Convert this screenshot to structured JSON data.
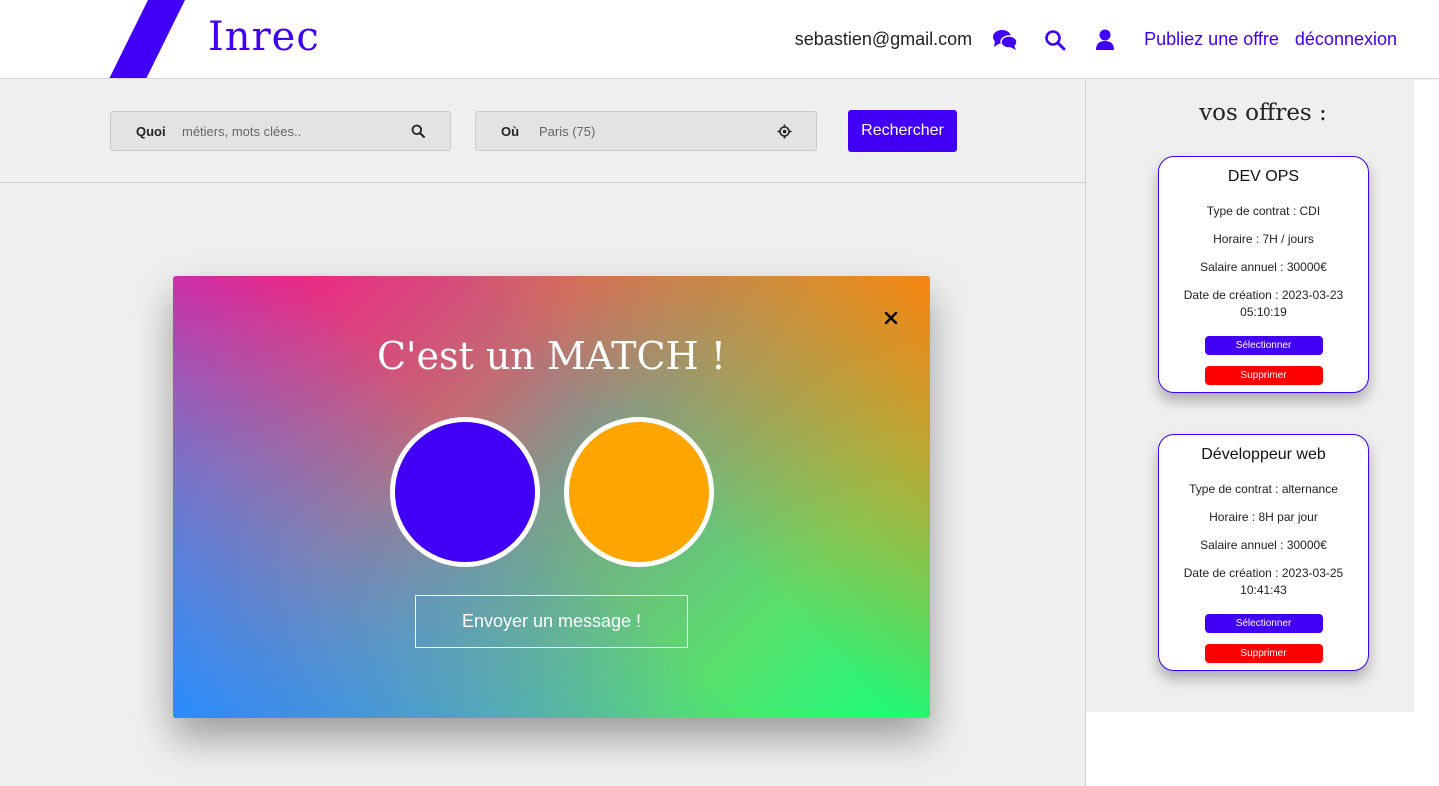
{
  "header": {
    "logo": "Inrec",
    "brand_color": "#4100f5",
    "email": "sebastien@gmail.com",
    "icons": [
      "chat-icon",
      "search-icon",
      "user-icon"
    ],
    "publish_link": "Publiez une offre",
    "logout_link": "déconnexion"
  },
  "search": {
    "quoi_label": "Quoi",
    "quoi_placeholder": "métiers, mots clées..",
    "ou_label": "Où",
    "ou_placeholder": "Paris (75)",
    "button_label": "Rechercher"
  },
  "sidebar": {
    "title": "vos offres :",
    "offers": [
      {
        "title": "DEV OPS",
        "contract": "Type de contrat : CDI",
        "hours": "Horaire : 7H / jours",
        "salary": "Salaire annuel : 30000€",
        "created": "Date de création : 2023-03-23 05:10:19",
        "select_label": "Sélectionner",
        "delete_label": "Supprimer"
      },
      {
        "title": "Développeur web",
        "contract": "Type de contrat : alternance",
        "hours": "Horaire : 8H par jour",
        "salary": "Salaire annuel : 30000€",
        "created": "Date de création : 2023-03-25 10:41:43",
        "select_label": "Sélectionner",
        "delete_label": "Supprimer"
      }
    ]
  },
  "modal": {
    "title": "C'est un MATCH !",
    "avatar_colors": [
      "#4100f5",
      "#ffa500"
    ],
    "message_button": "Envoyer un message !"
  }
}
